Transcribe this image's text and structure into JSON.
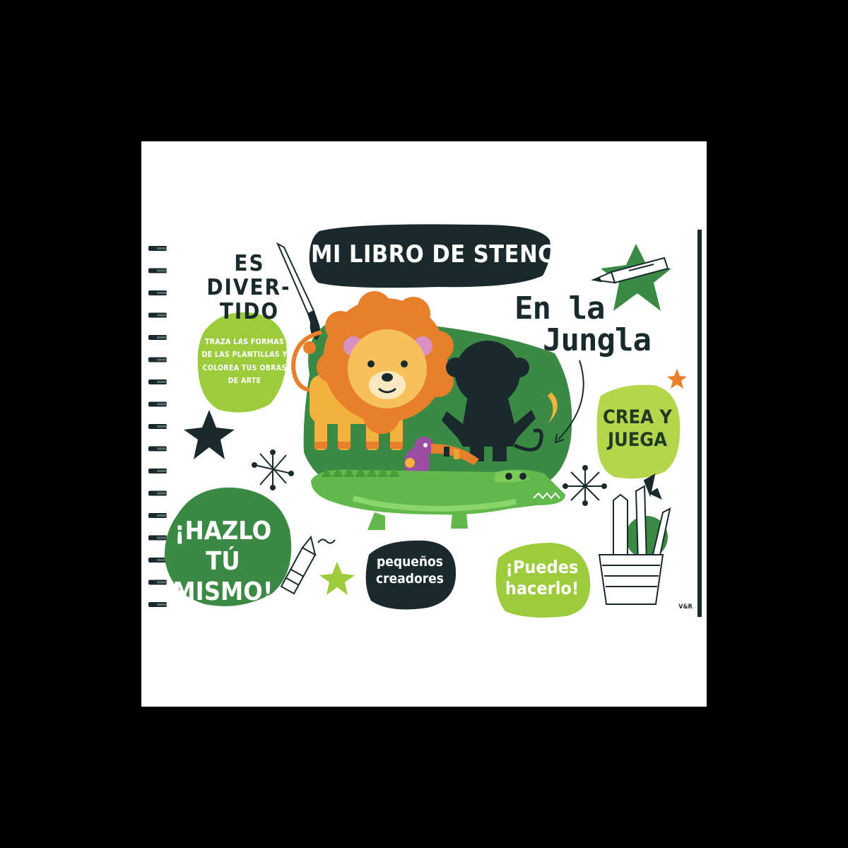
{
  "cover": {
    "title": "MI LIBRO DE STENCIL",
    "subtitle_line1": "En la",
    "subtitle_line2": "Jungla",
    "es_divertido": [
      "ES",
      "DIVER-",
      "TIDO"
    ],
    "traza_text": "TRAZA LAS FORMAS DE LAS PLANTILLAS Y COLOREA TUS OBRAS DE ARTE",
    "crea_y_juega": "CREA Y JUEGA",
    "hazlo": "¡HAZLO TÚ MISMO!",
    "pequenos": "pequeños creadores",
    "puedes": "¡Puedes hacerlo!",
    "publisher_logo": "V&R"
  },
  "colors": {
    "background": "#000000",
    "cover": "#ffffff",
    "dark_navy": "#1a2a2c",
    "green_dark": "#3a8a45",
    "green_light": "#9ccb3c",
    "lion_orange": "#e87f2a",
    "lion_yellow": "#f3b23c"
  },
  "icons": [
    "spiral-binding-icon",
    "paintbrush-icon",
    "pencil-icon",
    "crayon-icon",
    "pencil-cup-icon",
    "star-icon",
    "sparkle-icon",
    "lion-icon",
    "monkey-silhouette-icon",
    "toucan-icon",
    "crocodile-icon"
  ]
}
